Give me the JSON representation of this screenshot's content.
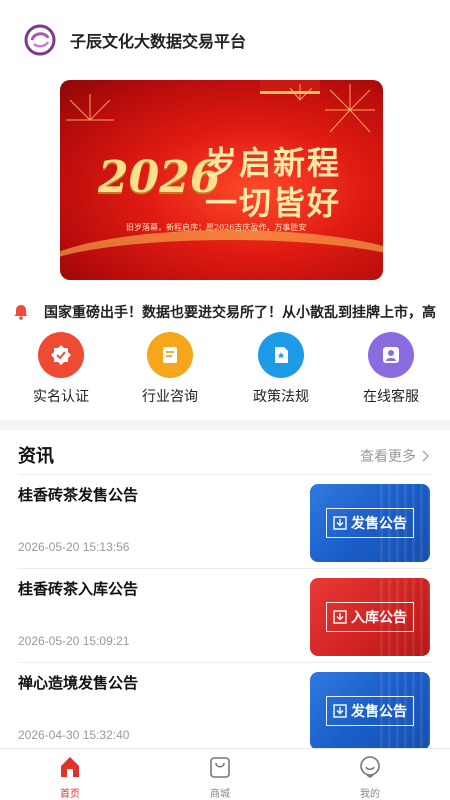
{
  "header": {
    "title": "子辰文化大数据交易平台"
  },
  "banner": {
    "year": "2026",
    "slogan_line1": "岁启新程",
    "slogan_line2": "一切皆好",
    "subline": "旧岁落幕，新程启序；愿2026吉庆盈作，万事胜安"
  },
  "ticker": {
    "text": "国家重磅出手！数据也要进交易所了！从小散乱到挂牌上市，高"
  },
  "quick_actions": [
    {
      "label": "实名认证",
      "icon": "verified-badge-icon",
      "color": "#ee4b32"
    },
    {
      "label": "行业咨询",
      "icon": "document-edit-icon",
      "color": "#f6a61b"
    },
    {
      "label": "政策法规",
      "icon": "policy-doc-icon",
      "color": "#1e9be8"
    },
    {
      "label": "在线客服",
      "icon": "customer-service-icon",
      "color": "#8b6be0"
    }
  ],
  "news": {
    "title": "资讯",
    "more_label": "查看更多",
    "items": [
      {
        "title": "桂香砖茶发售公告",
        "date": "2026-05-20 15:13:56",
        "thumb_label": "发售公告",
        "thumb_color": "blue"
      },
      {
        "title": "桂香砖茶入库公告",
        "date": "2026-05-20 15:09:21",
        "thumb_label": "入库公告",
        "thumb_color": "red"
      },
      {
        "title": "禅心造境发售公告",
        "date": "2026-04-30 15:32:40",
        "thumb_label": "发售公告",
        "thumb_color": "blue"
      }
    ]
  },
  "tabbar": [
    {
      "label": "首页",
      "icon": "home-icon",
      "active": true
    },
    {
      "label": "商城",
      "icon": "shopping-bag-icon",
      "active": false
    },
    {
      "label": "我的",
      "icon": "profile-icon",
      "active": false
    }
  ],
  "colors": {
    "accent": "#e0322a",
    "banner_red": "#e01b12"
  }
}
